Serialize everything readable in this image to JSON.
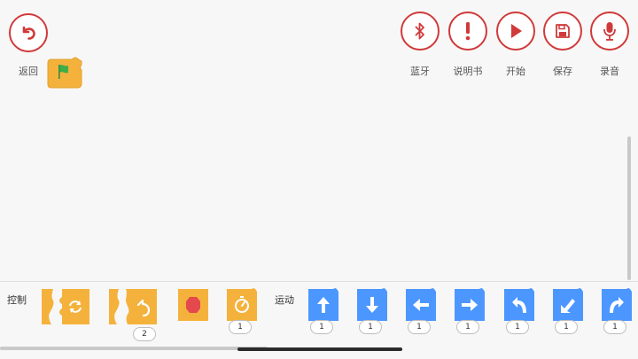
{
  "toolbar": {
    "back_label": "返回",
    "bluetooth_label": "蓝牙",
    "manual_label": "说明书",
    "start_label": "开始",
    "save_label": "保存",
    "record_label": "录音"
  },
  "palette": {
    "control_label": "控制",
    "motion_label": "运动",
    "control_blocks": [
      {
        "icon": "loop-forever-icon",
        "badge": ""
      },
      {
        "icon": "repeat-icon",
        "badge": "2"
      },
      {
        "icon": "stop-icon",
        "badge": ""
      },
      {
        "icon": "timer-icon",
        "badge": "1"
      }
    ],
    "motion_blocks": [
      {
        "icon": "arrow-up-icon",
        "badge": "1"
      },
      {
        "icon": "arrow-down-icon",
        "badge": "1"
      },
      {
        "icon": "arrow-left-icon",
        "badge": "1"
      },
      {
        "icon": "arrow-right-icon",
        "badge": "1"
      },
      {
        "icon": "turn-left-icon",
        "badge": "1"
      },
      {
        "icon": "turn-down-left-icon",
        "badge": "1"
      },
      {
        "icon": "turn-right-icon",
        "badge": "1"
      }
    ]
  },
  "colors": {
    "accent_red": "#d03a3a",
    "control_orange": "#f4b23c",
    "motion_blue": "#4c97ff",
    "flag_green": "#3fae49"
  }
}
